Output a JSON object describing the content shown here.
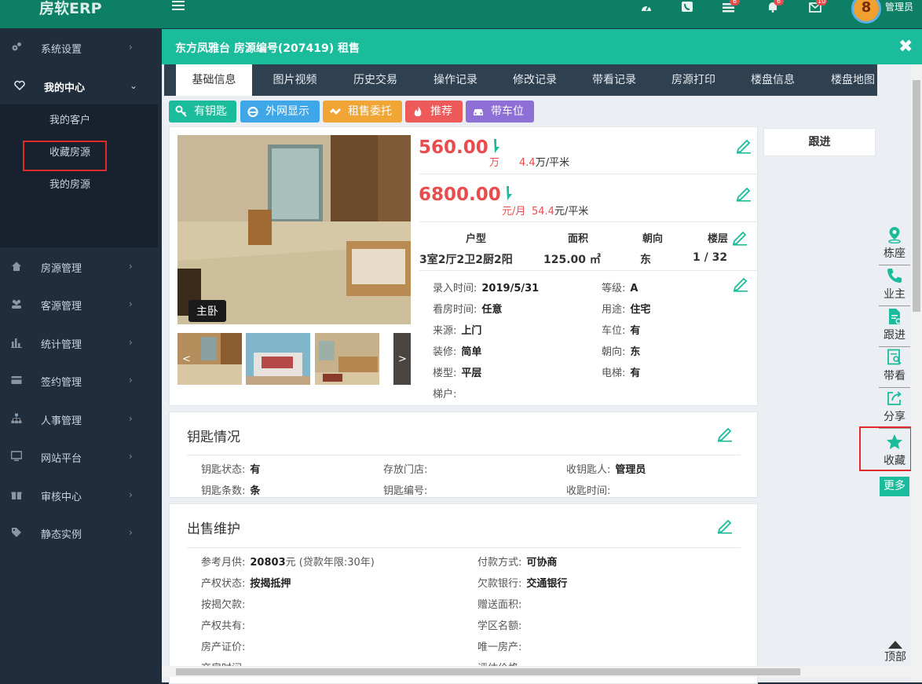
{
  "app": {
    "brand": "房软ERP",
    "user": "管理员",
    "avatar_text": "8"
  },
  "badges": {
    "mail_count": "6",
    "bell_count": "6",
    "msg_count": "10"
  },
  "sidebar": {
    "items": [
      {
        "label": "系统设置"
      },
      {
        "label": "我的中心"
      },
      {
        "label": "房源管理"
      },
      {
        "label": "客源管理"
      },
      {
        "label": "统计管理"
      },
      {
        "label": "签约管理"
      },
      {
        "label": "人事管理"
      },
      {
        "label": "网站平台"
      },
      {
        "label": "审核中心"
      },
      {
        "label": "静态实例"
      }
    ],
    "submenu": [
      "我的客户",
      "收藏房源",
      "我的房源"
    ]
  },
  "panel": {
    "title": "东方凤雅台 房源编号(207419) 租售",
    "close": "✖"
  },
  "tabs": [
    "基础信息",
    "图片视频",
    "历史交易",
    "操作记录",
    "修改记录",
    "带看记录",
    "房源打印",
    "楼盘信息",
    "楼盘地图"
  ],
  "tags": [
    "有钥匙",
    "外网显示",
    "租售委托",
    "推荐",
    "带车位"
  ],
  "photo": {
    "label": "主卧",
    "prev": "<",
    "next": ">"
  },
  "price": {
    "sale": "560.00",
    "sale_unit": "万",
    "sale_per_num": "4.4",
    "sale_per_unit": "万/平米",
    "rent": "6800.00",
    "rent_unit": "元/月",
    "rent_per_num": "54.4",
    "rent_per_unit": "元/平米"
  },
  "spec": {
    "headers": [
      "户型",
      "面积",
      "朝向",
      "楼层"
    ],
    "values": [
      "3室2厅2卫2厨2阳",
      "125.00 ㎡",
      "东",
      "1 / 32"
    ]
  },
  "details": {
    "left": [
      {
        "k": "录入时间:",
        "v": "2019/5/31"
      },
      {
        "k": "看房时间:",
        "v": "任意"
      },
      {
        "k": "来源:",
        "v": "上门"
      },
      {
        "k": "装修:",
        "v": "简单"
      },
      {
        "k": "楼型:",
        "v": "平层"
      },
      {
        "k": "梯户:",
        "v": ""
      }
    ],
    "right": [
      {
        "k": "等级:",
        "v": "A"
      },
      {
        "k": "用途:",
        "v": "住宅"
      },
      {
        "k": "车位:",
        "v": "有"
      },
      {
        "k": "朝向:",
        "v": "东"
      },
      {
        "k": "电梯:",
        "v": "有"
      }
    ]
  },
  "followup": "跟进",
  "keys": {
    "title": "钥匙情况",
    "rows": [
      [
        {
          "k": "钥匙状态:",
          "v": "有"
        },
        {
          "k": "存放门店:",
          "v": ""
        },
        {
          "k": "收钥匙人:",
          "v": "管理员"
        }
      ],
      [
        {
          "k": "钥匙条数:",
          "v": "条"
        },
        {
          "k": "钥匙编号:",
          "v": ""
        },
        {
          "k": "收匙时间:",
          "v": ""
        }
      ]
    ]
  },
  "sale": {
    "title": "出售维护",
    "monthly_k": "参考月供:",
    "monthly_v": "20803",
    "monthly_unit": "元",
    "monthly_note": "(贷款年限:30年)",
    "left": [
      {
        "k": "产权状态:",
        "v": "按揭抵押"
      },
      {
        "k": "按揭欠款:",
        "v": ""
      },
      {
        "k": "产权共有:",
        "v": ""
      },
      {
        "k": "房产证价:",
        "v": ""
      },
      {
        "k": "交房时间:",
        "v": ""
      }
    ],
    "right": [
      {
        "k": "付款方式:",
        "v": "可协商"
      },
      {
        "k": "欠款银行:",
        "v": "交通银行"
      },
      {
        "k": "赠送面积:",
        "v": ""
      },
      {
        "k": "学区名额:",
        "v": ""
      },
      {
        "k": "唯一房产:",
        "v": ""
      },
      {
        "k": "评估价格:",
        "v": ""
      }
    ]
  },
  "rightbar": [
    "栋座",
    "业主",
    "跟进",
    "带看",
    "分享",
    "收藏",
    "更多",
    "顶部"
  ]
}
